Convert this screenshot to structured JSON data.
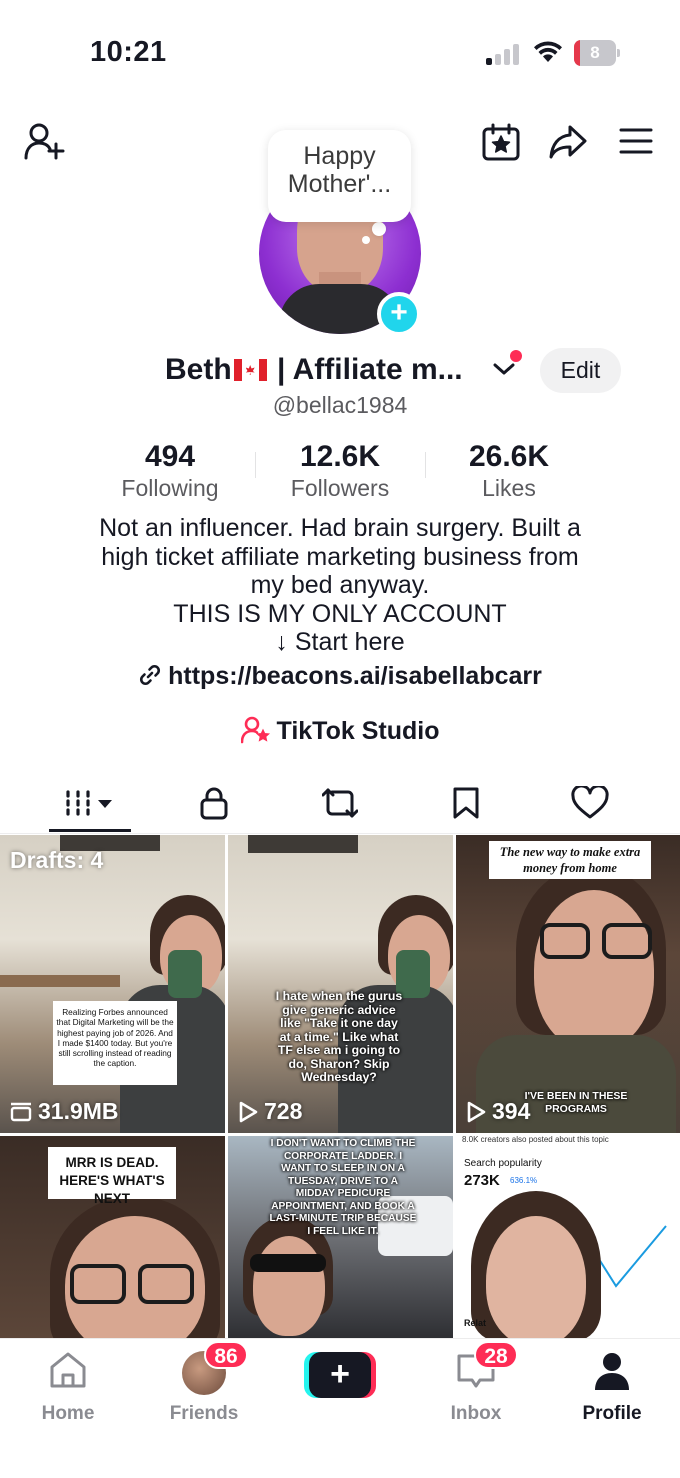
{
  "status_bar": {
    "time": "10:21",
    "battery": "8",
    "battery_level": 0.08,
    "battery_color": "#e5384b"
  },
  "top_nav": {
    "icons": [
      "add-friend-icon",
      "profile-views-icon",
      "share-icon",
      "menu-icon"
    ]
  },
  "profile": {
    "note_bubble": "Happy Mother'...",
    "display_name_prefix": "Beth",
    "display_name_suffix": " | Affiliate m...",
    "edit_label": "Edit",
    "username": "@bellac1984",
    "stats": [
      {
        "value": "494",
        "label": "Following"
      },
      {
        "value": "12.6K",
        "label": "Followers"
      },
      {
        "value": "26.6K",
        "label": "Likes"
      }
    ],
    "bio_lines": [
      "Not an influencer. Had brain surgery. Built a",
      "high ticket affiliate marketing business from",
      "my bed anyway.",
      "THIS IS MY ONLY ACCOUNT",
      "↓ Start here"
    ],
    "link": "https://beacons.ai/isabellabcarr",
    "studio_label": "TikTok Studio"
  },
  "tabs": [
    "videos-tab",
    "private-tab",
    "reposts-tab",
    "favorites-tab",
    "liked-tab"
  ],
  "grid": {
    "tiles": [
      {
        "top_label": "Drafts: 4",
        "caption": "Realizing Forbes announced that Digital Marketing will be the highest paying job of 2026. And I made $1400 today. But you're still scrolling instead of reading the caption.",
        "stat": "31.9MB"
      },
      {
        "caption": "I hate when the gurus give generic advice like \"Take it one day at a time.\" Like what TF else am i going to do, Sharon? Skip Wednesday?",
        "stat": "728"
      },
      {
        "caption": "The new way to make extra money from home",
        "caption_bottom": "I'VE BEEN IN THESE PROGRAMS",
        "stat": "394"
      },
      {
        "caption": "MRR IS DEAD. HERE'S WHAT'S NEXT"
      },
      {
        "caption": "I DON'T WANT TO CLIMB THE CORPORATE LADDER. I WANT TO SLEEP IN ON A TUESDAY, DRIVE TO A MIDDAY PEDICURE APPOINTMENT, AND BOOK A LAST-MINUTE TRIP BECAUSE I FEEL LIKE IT."
      },
      {
        "header": "8.0K creators also posted about this topic",
        "search_label": "Search popularity",
        "search_value": "273K",
        "search_change": "636.1%",
        "footer": "Relat"
      }
    ]
  },
  "bottom_nav": {
    "items": [
      {
        "label": "Home"
      },
      {
        "label": "Friends",
        "badge": "86"
      },
      {
        "label": ""
      },
      {
        "label": "Inbox",
        "badge": "28"
      },
      {
        "label": "Profile"
      }
    ]
  },
  "colors": {
    "accent_red": "#fe2c55",
    "accent_cyan": "#25f4ee",
    "text_primary": "#161823",
    "text_secondary": "#5b5b5f"
  }
}
